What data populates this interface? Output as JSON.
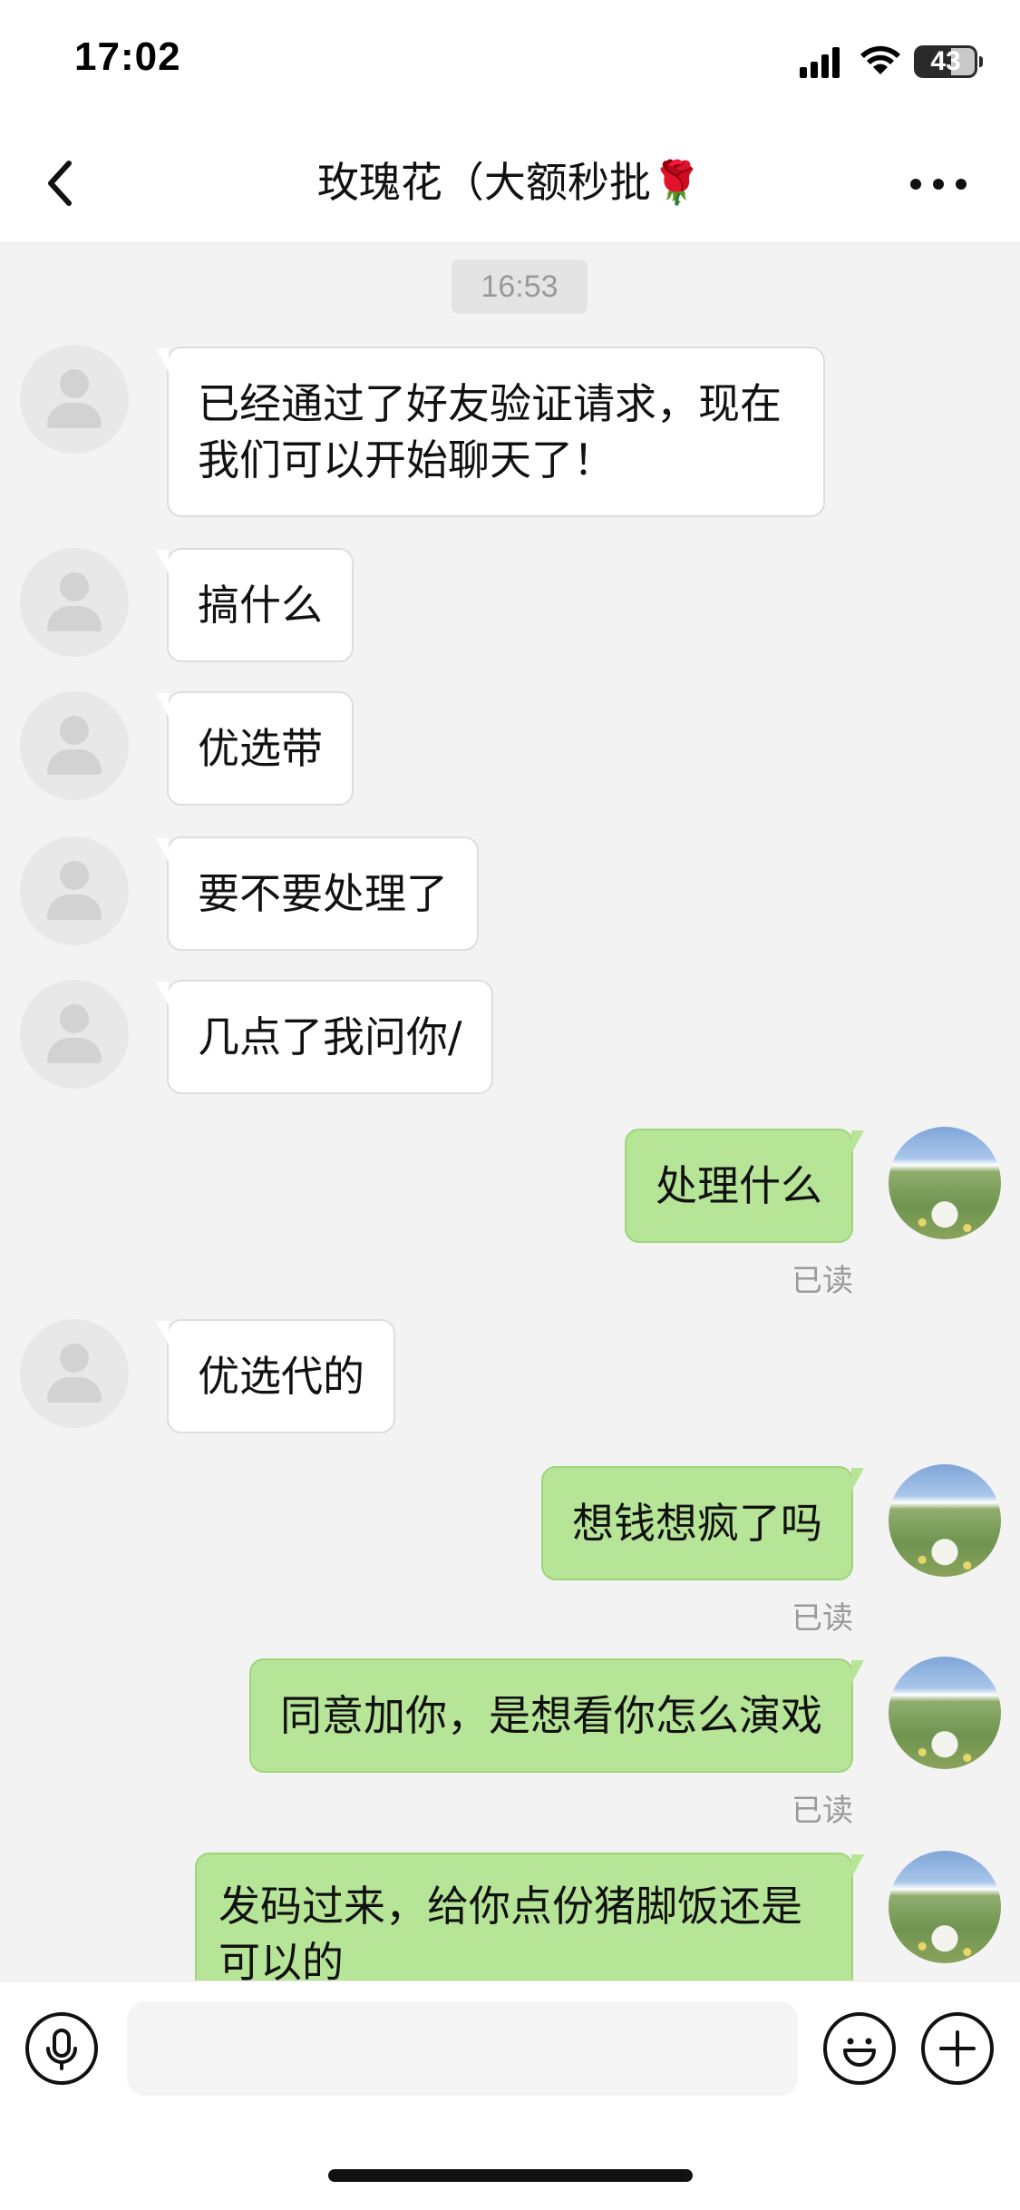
{
  "status_bar": {
    "time": "17:02",
    "battery": "43",
    "signal_icon": "cellular-signal-icon",
    "wifi_icon": "wifi-icon",
    "battery_icon": "battery-icon"
  },
  "nav": {
    "title": "玫瑰花（大额秒批🌹",
    "back_icon": "chevron-left-icon",
    "more_icon": "more-horizontal-icon"
  },
  "chat": {
    "timestamp": "16:53",
    "messages": [
      {
        "from": "other",
        "text": "已经通过了好友验证请求，现在我们可以开始聊天了！"
      },
      {
        "from": "other",
        "text": "搞什么"
      },
      {
        "from": "other",
        "text": "优选带"
      },
      {
        "from": "other",
        "text": "要不要处理了"
      },
      {
        "from": "other",
        "text": "几点了我问你/"
      },
      {
        "from": "self",
        "text": "处理什么",
        "status": "已读"
      },
      {
        "from": "other",
        "text": "优选代的"
      },
      {
        "from": "self",
        "text": "想钱想疯了吗",
        "status": "已读"
      },
      {
        "from": "self",
        "text": "同意加你，是想看你怎么演戏",
        "status": "已读"
      },
      {
        "from": "self",
        "text": "发码过来，给你点份猪脚饭还是可以的"
      }
    ]
  },
  "input_bar": {
    "placeholder": "",
    "voice_icon": "microphone-icon",
    "emoji_icon": "emoji-icon",
    "plus_icon": "plus-circle-icon"
  },
  "colors": {
    "self_bubble": "#b7e597",
    "other_bubble": "#ffffff",
    "chat_background": "#f3f3f3",
    "read_text": "#9a9a9a"
  }
}
